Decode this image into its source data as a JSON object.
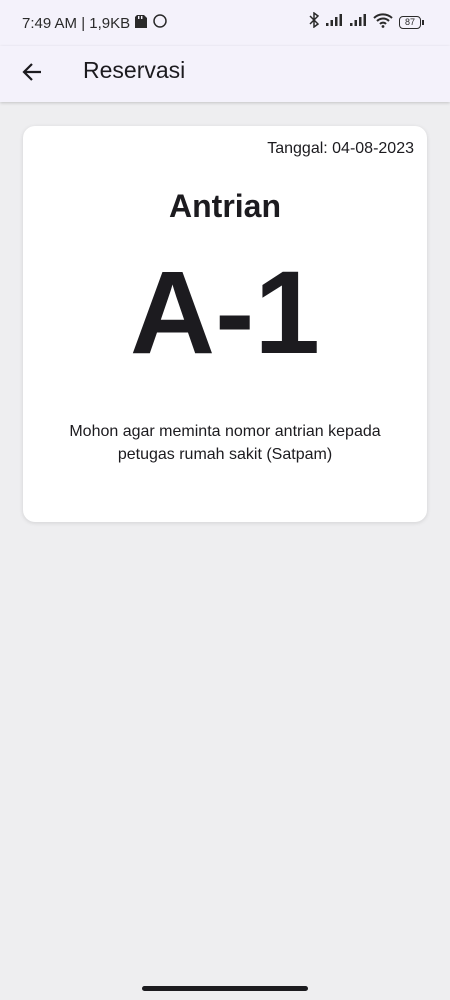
{
  "status_bar": {
    "time_info": "7:49 AM | 1,9KB",
    "battery_level": "87",
    "icons": [
      "sd-card-icon",
      "circle-sync-icon",
      "bluetooth-icon",
      "signal-1-icon",
      "signal-2-icon",
      "wifi-icon",
      "battery-icon"
    ]
  },
  "appbar": {
    "back_icon": "arrow-left-icon",
    "title": "Reservasi"
  },
  "card": {
    "date": "Tanggal: 04-08-2023",
    "queue_label": "Antrian",
    "queue_number": "A-1",
    "note": "Mohon agar meminta nomor antrian kepada petugas rumah sakit (Satpam)"
  },
  "colors": {
    "appbar_bg": "#f4f2fb",
    "page_bg": "#eeeef0",
    "card_bg": "#ffffff",
    "text": "#1c1b1f"
  }
}
